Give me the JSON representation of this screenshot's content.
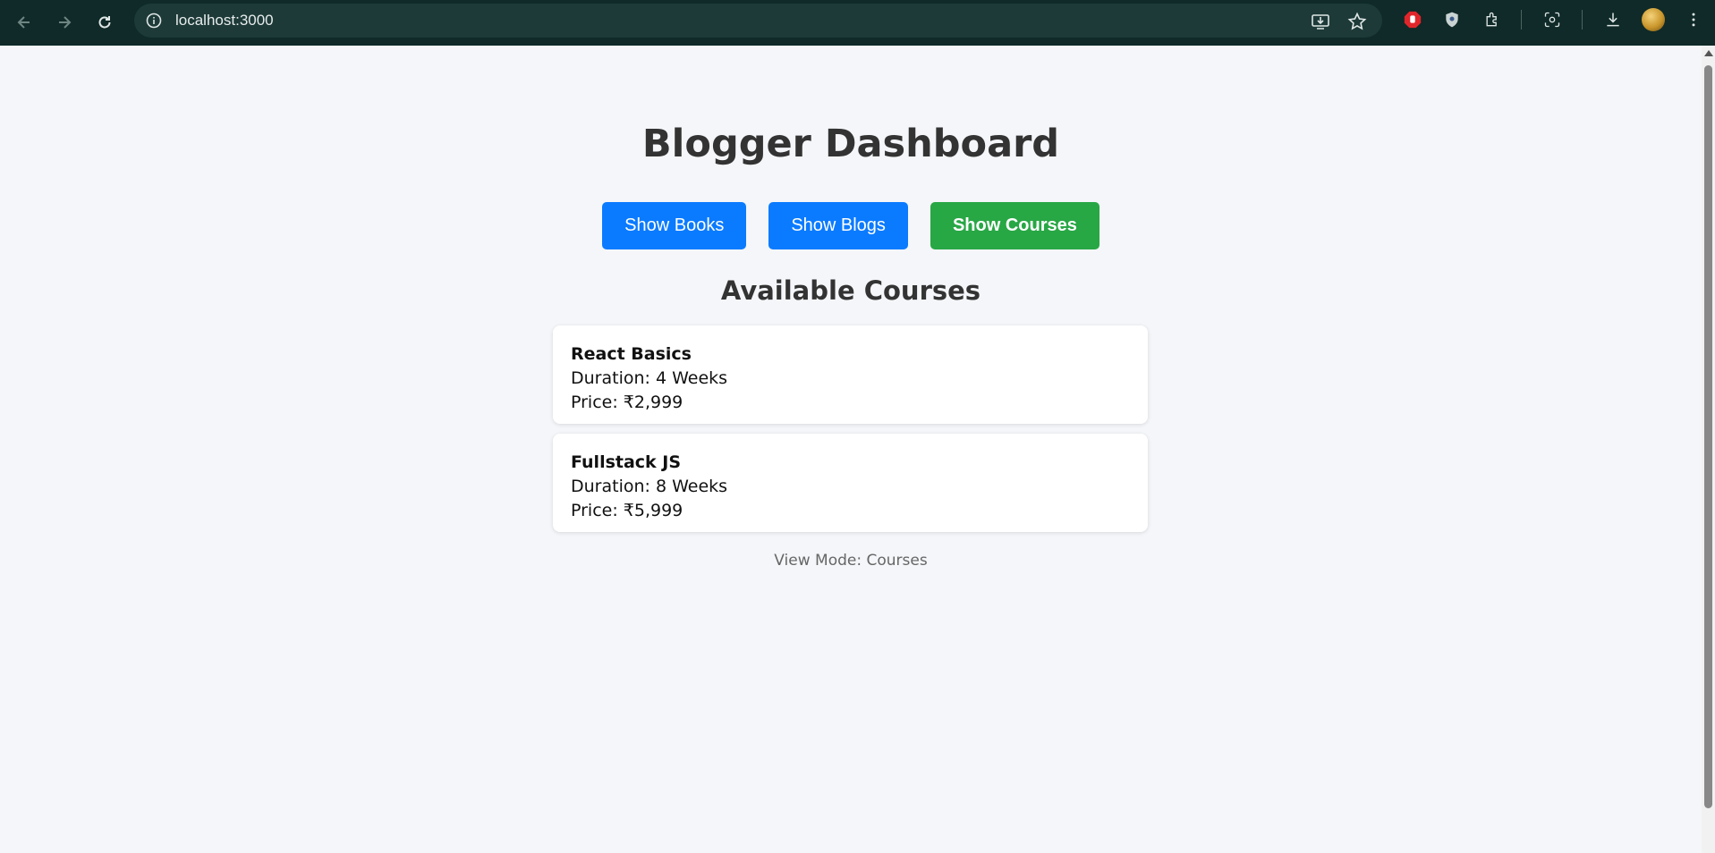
{
  "browser": {
    "url": "localhost:3000"
  },
  "page": {
    "title": "Blogger Dashboard",
    "buttons": {
      "books": "Show Books",
      "blogs": "Show Blogs",
      "courses": "Show Courses"
    },
    "section_title": "Available Courses",
    "courses": [
      {
        "name": "React Basics",
        "duration": "Duration: 4 Weeks",
        "price": "Price: ₹2,999"
      },
      {
        "name": "Fullstack JS",
        "duration": "Duration: 8 Weeks",
        "price": "Price: ₹5,999"
      }
    ],
    "view_mode": "View Mode: Courses"
  },
  "colors": {
    "primary_button": "#0a7bff",
    "active_button": "#28a745",
    "background": "#f4f6f9",
    "chrome": "#0f2a28"
  }
}
